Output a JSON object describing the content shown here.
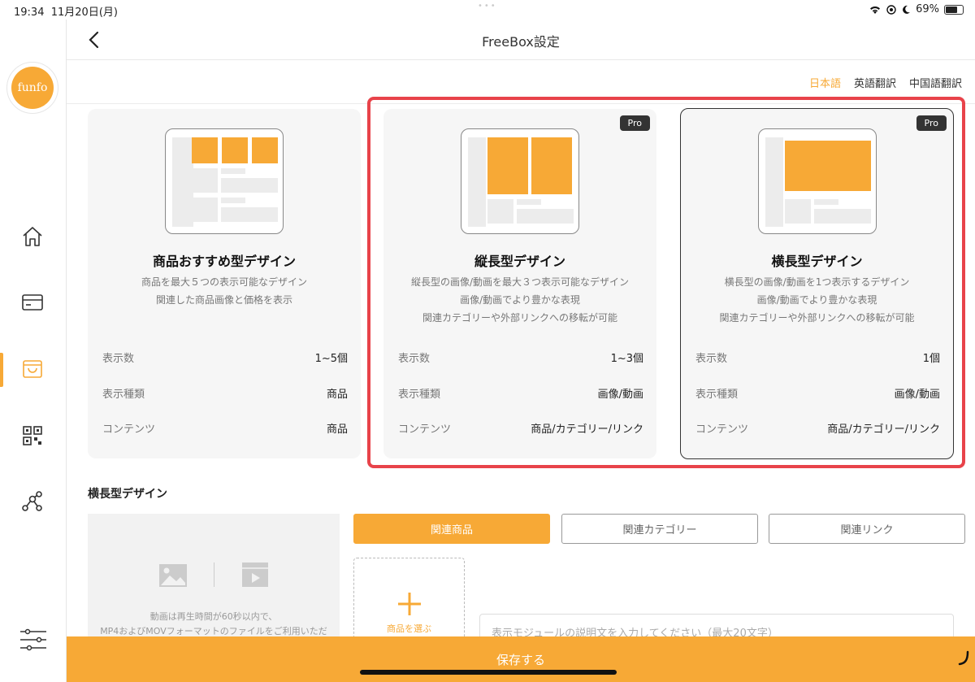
{
  "status": {
    "time": "19:34",
    "date": "11月20日(月)",
    "battery": "69%",
    "battery_level": 0.69
  },
  "app": {
    "logo_text": "funfo"
  },
  "header": {
    "title": "FreeBox設定"
  },
  "languages": [
    {
      "label": "日本語",
      "active": true
    },
    {
      "label": "英語翻訳",
      "active": false
    },
    {
      "label": "中国語翻訳",
      "active": false
    }
  ],
  "cards": [
    {
      "title": "商品おすすめ型デザイン",
      "desc": [
        "商品を最大５つの表示可能なデザイン",
        "関連した商品画像と価格を表示"
      ],
      "pro": "",
      "specs": [
        {
          "key": "表示数",
          "value": "1~5個"
        },
        {
          "key": "表示種類",
          "value": "商品"
        },
        {
          "key": "コンテンツ",
          "value": "商品"
        }
      ]
    },
    {
      "title": "縦長型デザイン",
      "desc": [
        "縦長型の画像/動画を最大３つ表示可能なデザイン",
        "画像/動画でより豊かな表現",
        "関連カテゴリーや外部リンクへの移転が可能"
      ],
      "pro": "Pro",
      "specs": [
        {
          "key": "表示数",
          "value": "1~3個"
        },
        {
          "key": "表示種類",
          "value": "画像/動画"
        },
        {
          "key": "コンテンツ",
          "value": "商品/カテゴリー/リンク"
        }
      ]
    },
    {
      "title": "横長型デザイン",
      "desc": [
        "横長型の画像/動画を1つ表示するデザイン",
        "画像/動画でより豊かな表現",
        "関連カテゴリーや外部リンクへの移転が可能"
      ],
      "pro": "Pro",
      "specs": [
        {
          "key": "表示数",
          "value": "1個"
        },
        {
          "key": "表示種類",
          "value": "画像/動画"
        },
        {
          "key": "コンテンツ",
          "value": "商品/カテゴリー/リンク"
        }
      ]
    }
  ],
  "section": {
    "title": "横長型デザイン",
    "media_note_1": "動画は再生時間が60秒以内で、",
    "media_note_2": "MP4およびMOVフォーマットのファイルをご利用いただ",
    "tabs": [
      {
        "label": "関連商品",
        "active": true
      },
      {
        "label": "関連カテゴリー",
        "active": false
      },
      {
        "label": "関連リンク",
        "active": false
      }
    ],
    "add_label": "商品を選ぶ",
    "desc_placeholder": "表示モジュールの説明文を入力してください（最大20文字）"
  },
  "save_label": "保存する",
  "colors": {
    "accent": "#f7a936",
    "highlight": "#e8434a"
  }
}
